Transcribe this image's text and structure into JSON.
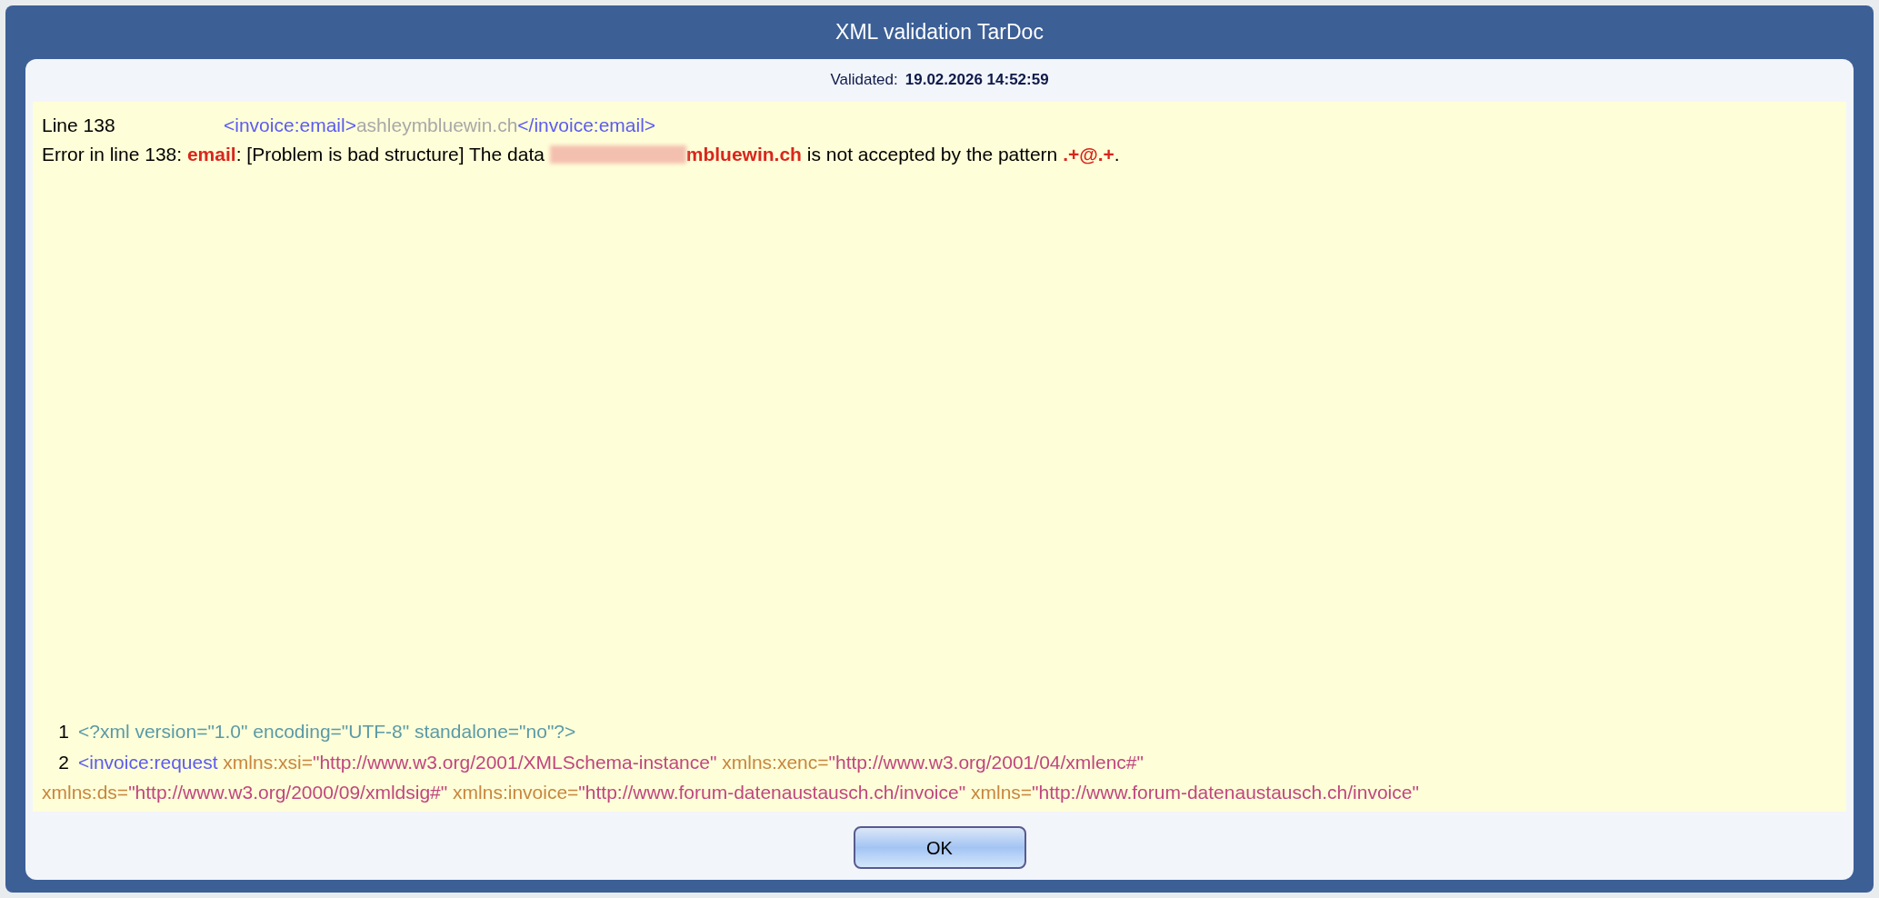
{
  "window": {
    "title": "XML validation TarDoc"
  },
  "validated": {
    "label": "Validated:",
    "value": "19.02.2026 14:52:59"
  },
  "error": {
    "line_label": "Line 138",
    "snippet": [
      {
        "kind": "tag",
        "text": "<invoice:email>"
      },
      {
        "kind": "content",
        "text": "ashleymbluewin.ch"
      },
      {
        "kind": "tag",
        "text": "</invoice:email>"
      }
    ],
    "message": [
      {
        "kind": "plain",
        "text": "Error in line 138: "
      },
      {
        "kind": "highlight",
        "text": "email"
      },
      {
        "kind": "plain",
        "text": ": [Problem is bad structure] The data "
      },
      {
        "kind": "redacted"
      },
      {
        "kind": "highlight",
        "text": "mbluewin.ch"
      },
      {
        "kind": "plain",
        "text": " is not accepted by the pattern "
      },
      {
        "kind": "highlight",
        "text": ".+@.+"
      },
      {
        "kind": "plain",
        "text": "."
      }
    ]
  },
  "code_lines": [
    {
      "number": "1",
      "tokens": [
        {
          "kind": "pi",
          "text": "<?xml version=\"1.0\" encoding=\"UTF-8\" standalone=\"no\"?>"
        }
      ]
    },
    {
      "number": "2",
      "tokens": [
        {
          "kind": "tag",
          "text": "<invoice:request"
        },
        {
          "kind": "attr",
          "text": " xmlns:xsi="
        },
        {
          "kind": "value",
          "text": "\"http://www.w3.org/2001/XMLSchema-instance\""
        },
        {
          "kind": "attr",
          "text": " xmlns:xenc="
        },
        {
          "kind": "value",
          "text": "\"http://www.w3.org/2001/04/xmlenc#\""
        },
        {
          "kind": "attr",
          "text": " xmlns:ds="
        },
        {
          "kind": "value",
          "text": "\"http://www.w3.org/2000/09/xmldsig#\""
        },
        {
          "kind": "attr",
          "text": " xmlns:invoice="
        },
        {
          "kind": "value",
          "text": "\"http://www.forum-datenaustausch.ch/invoice\""
        },
        {
          "kind": "attr",
          "text": " xmlns="
        },
        {
          "kind": "value",
          "text": "\"http://www.forum-datenaustausch.ch/invoice\""
        }
      ]
    }
  ],
  "buttons": [
    {
      "label": "OK"
    }
  ]
}
